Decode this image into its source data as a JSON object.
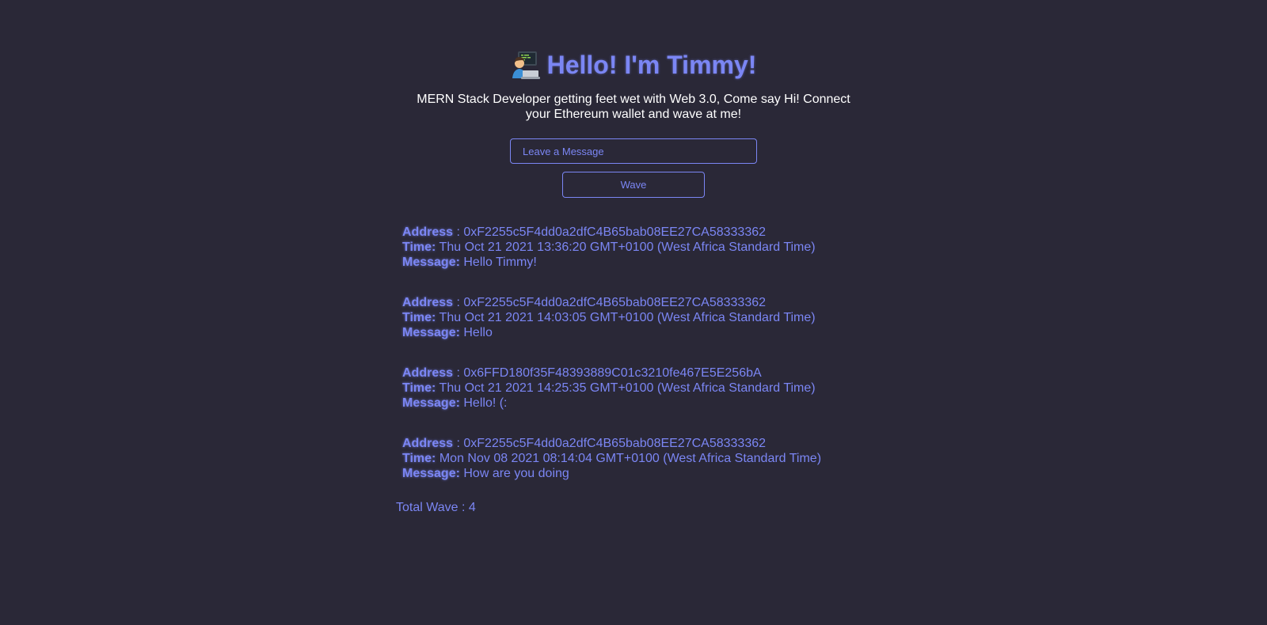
{
  "header": {
    "title": "Hello! I'm Timmy!",
    "title_icon": "technologist-emoji-icon",
    "subtitle": "MERN Stack Developer getting feet wet with Web 3.0, Come say Hi! Connect your Ethereum wallet and wave at me!"
  },
  "form": {
    "message_placeholder": "Leave a Message",
    "message_value": "",
    "wave_label": "Wave"
  },
  "labels": {
    "address": "Address",
    "address_sep": " : ",
    "time": "Time:",
    "message": "Message:"
  },
  "waves": [
    {
      "address": "0xF2255c5F4dd0a2dfC4B65bab08EE27CA58333362",
      "time": "Thu Oct 21 2021 13:36:20 GMT+0100 (West Africa Standard Time)",
      "message": "Hello Timmy!"
    },
    {
      "address": "0xF2255c5F4dd0a2dfC4B65bab08EE27CA58333362",
      "time": "Thu Oct 21 2021 14:03:05 GMT+0100 (West Africa Standard Time)",
      "message": "Hello"
    },
    {
      "address": "0x6FFD180f35F48393889C01c3210fe467E5E256bA",
      "time": "Thu Oct 21 2021 14:25:35 GMT+0100 (West Africa Standard Time)",
      "message": "Hello! (:"
    },
    {
      "address": "0xF2255c5F4dd0a2dfC4B65bab08EE27CA58333362",
      "time": "Mon Nov 08 2021 08:14:04 GMT+0100 (West Africa Standard Time)",
      "message": "How are you doing"
    }
  ],
  "total": {
    "label": "Total Wave : ",
    "count": "4"
  },
  "colors": {
    "background": "#2a2837",
    "accent": "#7b86f4",
    "text": "#ffffff"
  }
}
